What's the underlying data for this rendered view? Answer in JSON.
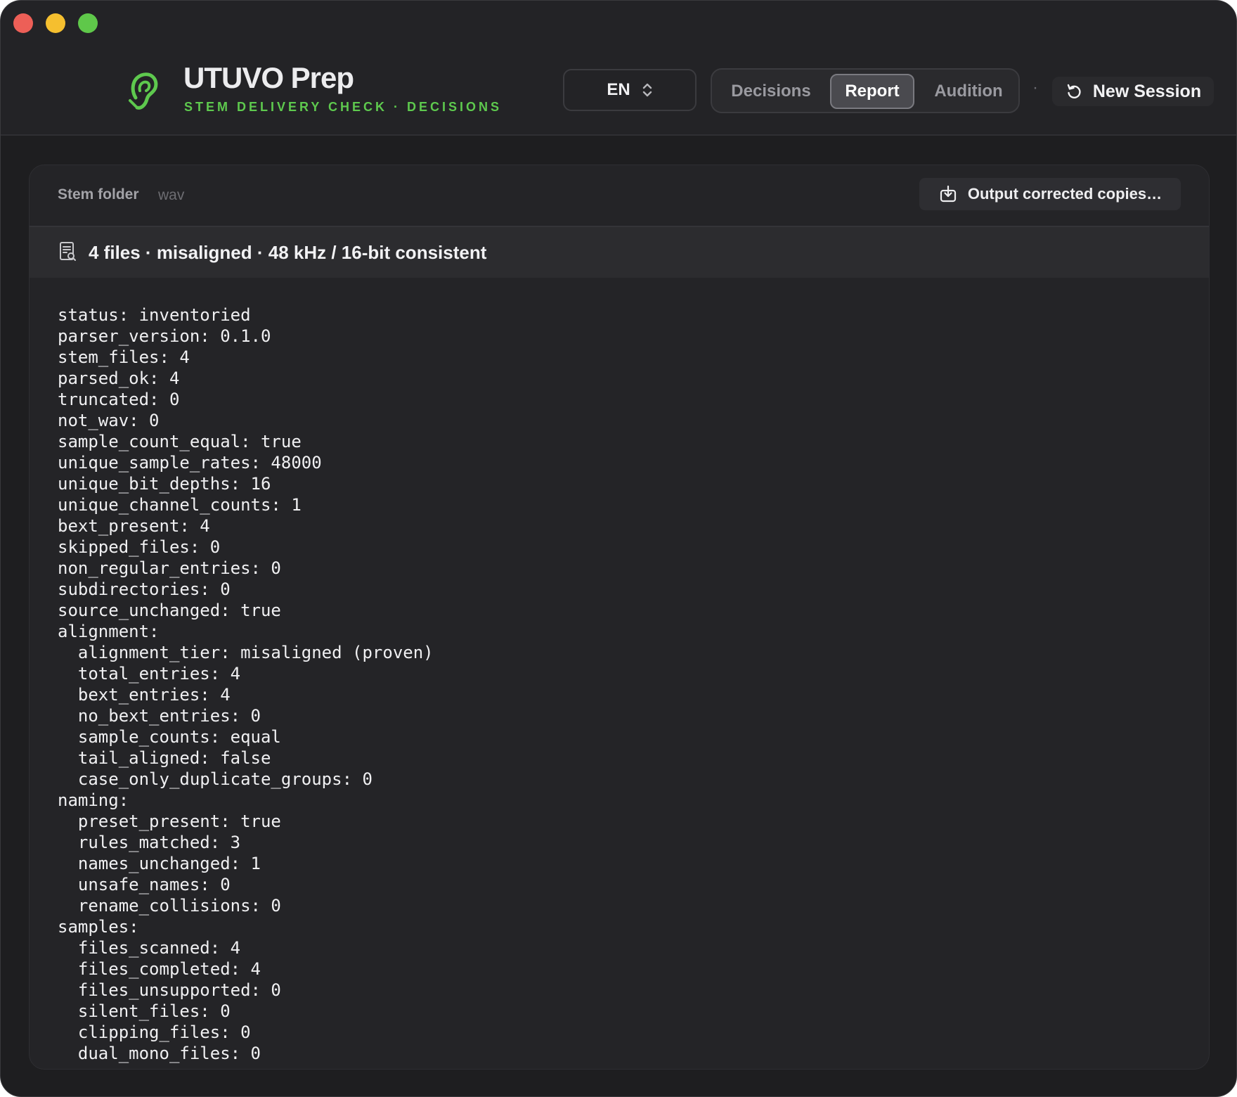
{
  "window": {
    "controls": [
      "close",
      "minimize",
      "zoom"
    ]
  },
  "header": {
    "app_title": "UTUVO Prep",
    "app_subtitle": "STEM DELIVERY CHECK · DECISIONS",
    "logo_icon": "ear-icon",
    "accent_color": "#5ec94e",
    "language": {
      "value": "EN",
      "icon": "chevron-up-down-icon"
    },
    "tabs": [
      {
        "label": "Decisions",
        "active": false
      },
      {
        "label": "Report",
        "active": true
      },
      {
        "label": "Audition",
        "active": false
      }
    ],
    "separator": "·",
    "new_session": {
      "label": "New Session",
      "icon": "reset-icon"
    }
  },
  "panel": {
    "stem_folder_label": "Stem folder",
    "stem_folder_value": "wav",
    "output_button": {
      "label": "Output corrected copies…",
      "icon": "export-icon"
    },
    "summary": {
      "text": "4 files · misaligned · 48 kHz / 16-bit consistent",
      "icon": "document-search-icon"
    },
    "report_lines": [
      "status: inventoried",
      "parser_version: 0.1.0",
      "stem_files: 4",
      "parsed_ok: 4",
      "truncated: 0",
      "not_wav: 0",
      "sample_count_equal: true",
      "unique_sample_rates: 48000",
      "unique_bit_depths: 16",
      "unique_channel_counts: 1",
      "bext_present: 4",
      "skipped_files: 0",
      "non_regular_entries: 0",
      "subdirectories: 0",
      "source_unchanged: true",
      "alignment:",
      "  alignment_tier: misaligned (proven)",
      "  total_entries: 4",
      "  bext_entries: 4",
      "  no_bext_entries: 0",
      "  sample_counts: equal",
      "  tail_aligned: false",
      "  case_only_duplicate_groups: 0",
      "naming:",
      "  preset_present: true",
      "  rules_matched: 3",
      "  names_unchanged: 1",
      "  unsafe_names: 0",
      "  rename_collisions: 0",
      "samples:",
      "  files_scanned: 4",
      "  files_completed: 4",
      "  files_unsupported: 0",
      "  silent_files: 0",
      "  clipping_files: 0",
      "  dual_mono_files: 0"
    ]
  }
}
